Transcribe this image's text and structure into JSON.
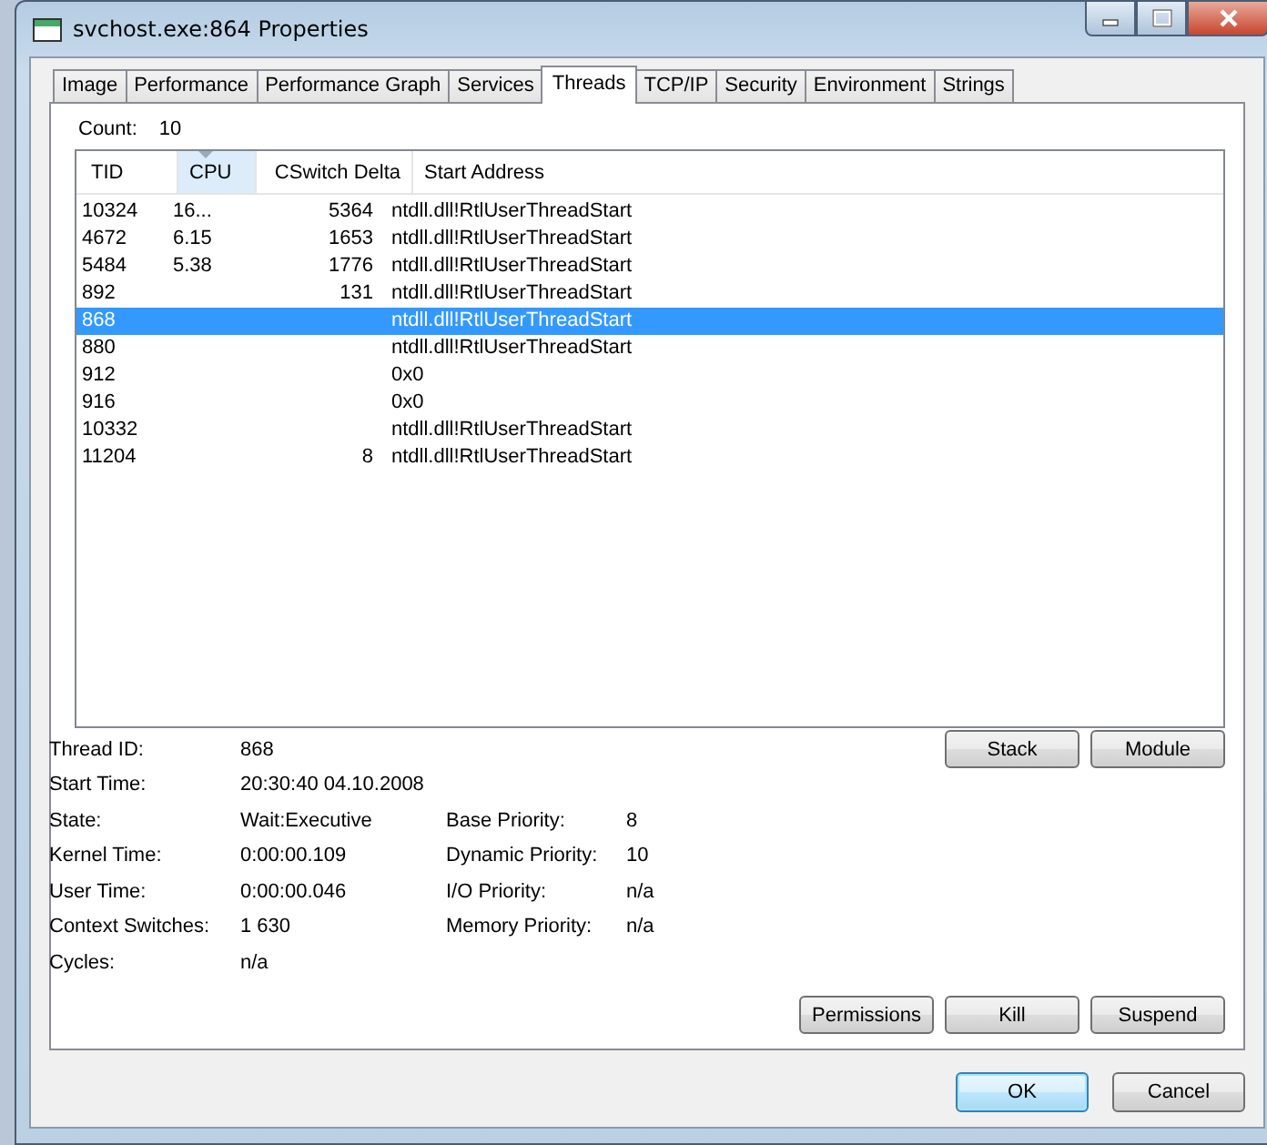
{
  "window": {
    "title": "svchost.exe:864 Properties"
  },
  "tabs": [
    {
      "label": "Image",
      "selected": false
    },
    {
      "label": "Performance",
      "selected": false
    },
    {
      "label": "Performance Graph",
      "selected": false
    },
    {
      "label": "Services",
      "selected": false
    },
    {
      "label": "Threads",
      "selected": true
    },
    {
      "label": "TCP/IP",
      "selected": false
    },
    {
      "label": "Security",
      "selected": false
    },
    {
      "label": "Environment",
      "selected": false
    },
    {
      "label": "Strings",
      "selected": false
    }
  ],
  "count": {
    "label": "Count:",
    "value": "10"
  },
  "table": {
    "columns": [
      {
        "label": "TID",
        "sorted": false
      },
      {
        "label": "CPU",
        "sorted": true
      },
      {
        "label": "CSwitch Delta",
        "sorted": false
      },
      {
        "label": "Start Address",
        "sorted": false
      }
    ],
    "rows": [
      {
        "cells": [
          "10324",
          "16...",
          "5364",
          "ntdll.dll!RtlUserThreadStart"
        ],
        "selected": false
      },
      {
        "cells": [
          "4672",
          "6.15",
          "1653",
          "ntdll.dll!RtlUserThreadStart"
        ],
        "selected": false
      },
      {
        "cells": [
          "5484",
          "5.38",
          "1776",
          "ntdll.dll!RtlUserThreadStart"
        ],
        "selected": false
      },
      {
        "cells": [
          "892",
          "",
          "131",
          "ntdll.dll!RtlUserThreadStart"
        ],
        "selected": false
      },
      {
        "cells": [
          "868",
          "",
          "",
          "ntdll.dll!RtlUserThreadStart"
        ],
        "selected": true
      },
      {
        "cells": [
          "880",
          "",
          "",
          "ntdll.dll!RtlUserThreadStart"
        ],
        "selected": false
      },
      {
        "cells": [
          "912",
          "",
          "",
          "0x0"
        ],
        "selected": false
      },
      {
        "cells": [
          "916",
          "",
          "",
          "0x0"
        ],
        "selected": false
      },
      {
        "cells": [
          "10332",
          "",
          "",
          "ntdll.dll!RtlUserThreadStart"
        ],
        "selected": false
      },
      {
        "cells": [
          "11204",
          "",
          "8",
          "ntdll.dll!RtlUserThreadStart"
        ],
        "selected": false
      }
    ]
  },
  "table_buttons": [
    "Stack",
    "Module"
  ],
  "details": {
    "top": [
      {
        "label": "Thread ID:",
        "value": "868"
      },
      {
        "label": "Start Time:",
        "value": "20:30:40   04.10.2008"
      }
    ],
    "left": [
      {
        "label": "State:",
        "value": "Wait:Executive"
      },
      {
        "label": "Kernel Time:",
        "value": "0:00:00.109"
      },
      {
        "label": "User Time:",
        "value": "0:00:00.046"
      },
      {
        "label": "Context Switches:",
        "value": "1 630"
      },
      {
        "label": "Cycles:",
        "value": "n/a"
      }
    ],
    "right": [
      {
        "label": "Base Priority:",
        "value": "8"
      },
      {
        "label": "Dynamic Priority:",
        "value": "10"
      },
      {
        "label": "I/O Priority:",
        "value": "n/a"
      },
      {
        "label": "Memory Priority:",
        "value": "n/a"
      }
    ]
  },
  "thread_buttons": [
    "Permissions",
    "Kill",
    "Suspend"
  ],
  "dialog_buttons": [
    {
      "label": "OK",
      "default": true
    },
    {
      "label": "Cancel",
      "default": false
    }
  ]
}
